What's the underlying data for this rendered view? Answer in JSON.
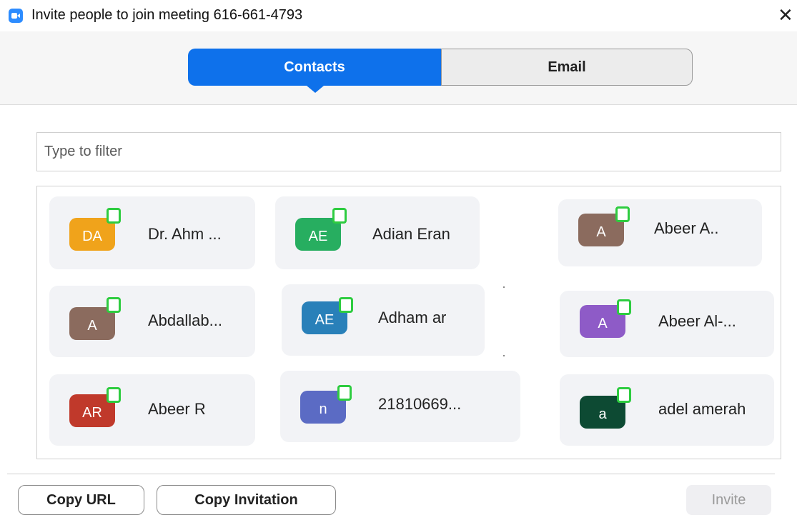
{
  "window": {
    "title": "Invite people to join meeting 616-661-4793",
    "close_glyph": "✕"
  },
  "tabs": [
    {
      "label": "Contacts",
      "active": true
    },
    {
      "label": "Email",
      "active": false
    }
  ],
  "filter": {
    "placeholder": "Type to filter",
    "value": ""
  },
  "contacts": [
    {
      "initials": "DA",
      "name": "Dr. Ahm ...",
      "avatar_color": "#F0A31B",
      "status": "online"
    },
    {
      "initials": "AE",
      "name": "Adian Eran",
      "avatar_color": "#27AE60",
      "status": "online"
    },
    {
      "initials": "A",
      "name": "Abeer A..",
      "avatar_color": "#8B6B5E",
      "status": "online"
    },
    {
      "initials": "A",
      "name": "Abdallab...",
      "avatar_color": "#8B6B5E",
      "status": "online"
    },
    {
      "initials": "AE",
      "name": "Adham ar",
      "avatar_color": "#2980B9",
      "status": "online"
    },
    {
      "initials": "A",
      "name": "Abeer Al-...",
      "avatar_color": "#8E5BC7",
      "status": "online"
    },
    {
      "initials": "AR",
      "name": "Abeer R",
      "avatar_color": "#C0392B",
      "status": "online"
    },
    {
      "initials": "n",
      "name": "21810669...",
      "avatar_color": "#5B6BC4",
      "status": "online"
    },
    {
      "initials": "a",
      "name": "adel amerah",
      "avatar_color": "#0D4A33",
      "status": "online"
    }
  ],
  "footer": {
    "copy_url": "Copy URL",
    "copy_invitation": "Copy Invitation",
    "invite": "Invite"
  },
  "colors": {
    "accent": "#0E71EB",
    "presence": "#2ecc40"
  }
}
